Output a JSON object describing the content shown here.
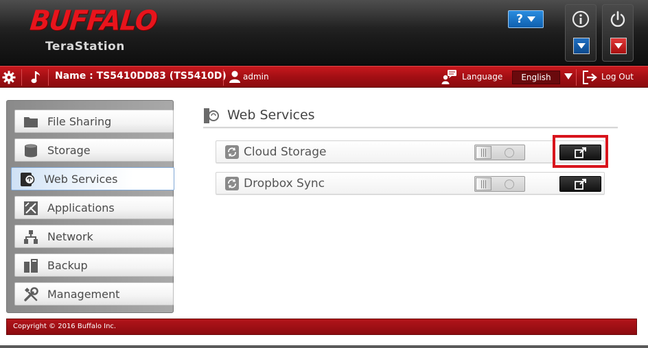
{
  "header": {
    "brand": "BUFFALO",
    "product": "TeraStation",
    "help_label": "?",
    "info_icon": "info-icon",
    "power_icon": "power-icon"
  },
  "statusbar": {
    "device_name": "Name : TS5410DD83 (TS5410D)",
    "user": "admin",
    "language_label": "Language",
    "language_value": "English",
    "logout_label": "Log Out"
  },
  "sidebar": {
    "items": [
      {
        "label": "File Sharing",
        "icon": "folder-icon"
      },
      {
        "label": "Storage",
        "icon": "storage-icon"
      },
      {
        "label": "Web Services",
        "icon": "web-services-icon",
        "active": true
      },
      {
        "label": "Applications",
        "icon": "applications-icon"
      },
      {
        "label": "Network",
        "icon": "network-icon"
      },
      {
        "label": "Backup",
        "icon": "backup-icon"
      },
      {
        "label": "Management",
        "icon": "management-icon"
      }
    ]
  },
  "main": {
    "title": "Web Services",
    "services": [
      {
        "label": "Cloud Storage",
        "enabled": false
      },
      {
        "label": "Dropbox Sync",
        "enabled": false
      }
    ]
  },
  "footer": {
    "copyright": "Copyright © 2016 Buffalo Inc."
  },
  "colors": {
    "brand_red": "#e8141c",
    "bar_red": "#a30f14",
    "highlight": "#d8141c"
  }
}
